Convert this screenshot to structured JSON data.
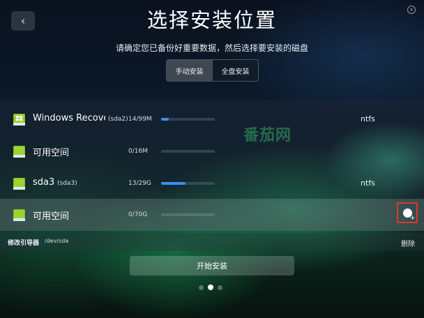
{
  "header": {
    "title": "选择安装位置",
    "subtitle": "请确定您已备份好重要数据，然后选择要安装的磁盘",
    "back_icon": "‹",
    "close_icon": "×"
  },
  "mode_tabs": [
    {
      "label": "手动安装",
      "active": true
    },
    {
      "label": "全盘安装",
      "active": false
    }
  ],
  "partitions": [
    {
      "name": "Windows Recovery",
      "device": "(sda2)",
      "size": "14/99M",
      "used_fraction": 0.14,
      "fs": "ntfs",
      "icon": "windows-disk-icon"
    },
    {
      "name": "可用空间",
      "device": "",
      "size": "0/16M",
      "used_fraction": 0,
      "fs": "",
      "icon": "disk-icon"
    },
    {
      "name": "sda3",
      "device": "(sda3)",
      "size": "13/29G",
      "used_fraction": 0.45,
      "fs": "ntfs",
      "icon": "disk-icon"
    },
    {
      "name": "可用空间",
      "device": "",
      "size": "0/70G",
      "used_fraction": 0,
      "fs": "",
      "icon": "disk-icon",
      "selected": true
    }
  ],
  "watermark": "番茄网",
  "bootloader": {
    "label": "修改引导器",
    "device": "/dev/sda",
    "delete_label": "删除"
  },
  "install_button": "开始安装",
  "pager": {
    "pages": 3,
    "current": 2
  },
  "colors": {
    "accent": "#3a8ef0",
    "disk_icon": "#9ad42f",
    "highlight_border": "#d63a2f"
  }
}
